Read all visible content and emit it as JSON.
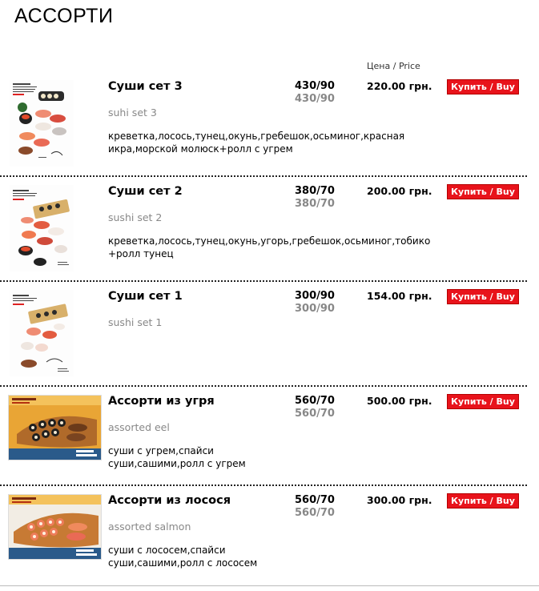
{
  "page": {
    "title": "АССОРТИ"
  },
  "price_header": "Цена / Price",
  "buy_label": "Купить / Buy",
  "items": [
    {
      "name": "Суши сет 3",
      "subtitle": "suhi set 3",
      "description": "креветка,лосось,тунец,окунь,гребешок,осьминог,красная икра,морской молюск+ролл с угрем",
      "weight_1": "430/90",
      "weight_2": "430/90",
      "price": "220.00 грн.",
      "image_icon": "sushi-set-3-menu-card"
    },
    {
      "name": "Суши сет 2",
      "subtitle": "sushi set 2",
      "description": "креветка,лосось,тунец,окунь,угорь,гребешок,осьминог,тобико +ролл тунец",
      "weight_1": "380/70",
      "weight_2": "380/70",
      "price": "200.00 грн.",
      "image_icon": "sushi-set-2-menu-card"
    },
    {
      "name": "Суши сет 1",
      "subtitle": "sushi set 1",
      "description": "",
      "weight_1": "300/90",
      "weight_2": "300/90",
      "price": "154.00 грн.",
      "image_icon": "sushi-set-1-menu-card"
    },
    {
      "name": "Ассорти из угря",
      "subtitle": "assorted eel",
      "description": "суши с угрем,спайси суши,сашими,ролл с угрем",
      "weight_1": "560/70",
      "weight_2": "560/70",
      "price": "500.00 грн.",
      "image_icon": "eel-assortment-photo"
    },
    {
      "name": "Ассорти из лосося",
      "subtitle": "assorted salmon",
      "description": "суши с лососем,спайси суши,сашими,ролл с лососем",
      "weight_1": "560/70",
      "weight_2": "560/70",
      "price": "300.00 грн.",
      "image_icon": "salmon-assortment-photo"
    }
  ],
  "colors": {
    "buy_button": "#e8131b",
    "secondary_text": "#888888",
    "separator": "#222222"
  }
}
